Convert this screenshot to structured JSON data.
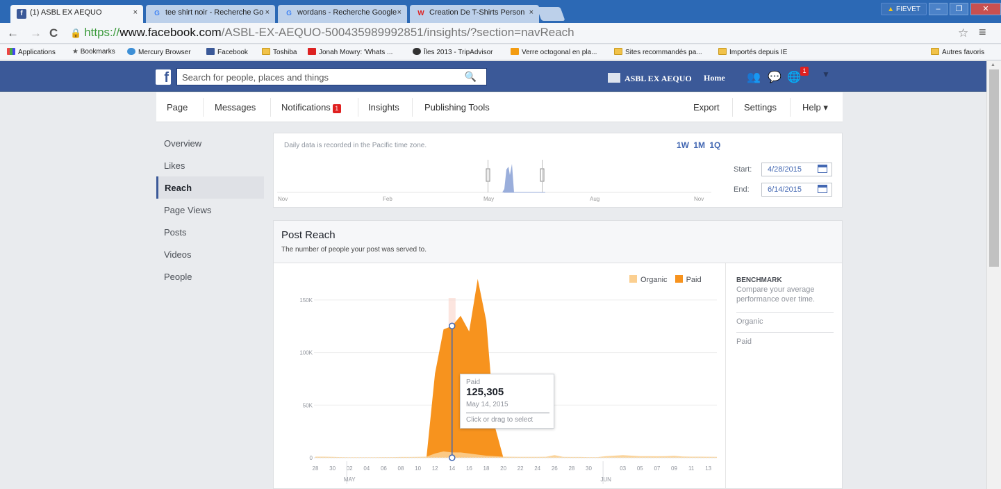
{
  "browser": {
    "tabs": [
      {
        "title": "(1) ASBL EX AEQUO",
        "favicon": "facebook-icon",
        "active": true
      },
      {
        "title": "tee shirt noir - Recherche Go",
        "favicon": "google-icon",
        "active": false
      },
      {
        "title": "wordans - Recherche Google",
        "favicon": "google-icon",
        "active": false
      },
      {
        "title": "Creation De T-Shirts Person",
        "favicon": "wordans-icon",
        "active": false
      }
    ],
    "user": "FIEVET",
    "url_scheme": "https://",
    "url_host": "www.facebook.com",
    "url_path": "/ASBL-EX-AEQUO-500435989992851/insights/?section=navReach",
    "bookmarks": [
      "Applications",
      "Bookmarks",
      "Mercury Browser",
      "Facebook",
      "Toshiba",
      "Jonah Mowry: 'Whats ...",
      "Îles 2013 - TripAdvisor",
      "Verre octogonal en pla...",
      "Sites recommandés pa...",
      "Importés depuis IE"
    ],
    "other_bookmarks": "Autres favoris"
  },
  "fb": {
    "search_placeholder": "Search for people, places and things",
    "page_name": "ASBL EX AEQUO",
    "home": "Home",
    "notif_count": "1"
  },
  "pagenav": {
    "page": "Page",
    "messages": "Messages",
    "notifications": "Notifications",
    "notifications_badge": "1",
    "insights": "Insights",
    "publishing": "Publishing Tools",
    "export": "Export",
    "settings": "Settings",
    "help": "Help ▾"
  },
  "sidebar": {
    "items": [
      "Overview",
      "Likes",
      "Reach",
      "Page Views",
      "Posts",
      "Videos",
      "People"
    ],
    "active": "Reach"
  },
  "timeline": {
    "note": "Daily data is recorded in the Pacific time zone.",
    "ranges": "1W 1M 1Q",
    "months": [
      "Nov",
      "Feb",
      "May",
      "Aug",
      "Nov"
    ],
    "start_label": "Start:",
    "start_date": "4/28/2015",
    "end_label": "End:",
    "end_date": "6/14/2015"
  },
  "reach": {
    "title": "Post Reach",
    "subtitle": "The number of people your post was served to."
  },
  "benchmark": {
    "title": "BENCHMARK",
    "desc": "Compare your average performance over time.",
    "organic": "Organic",
    "paid": "Paid"
  },
  "tooltip": {
    "series": "Paid",
    "value": "125,305",
    "date": "May 14, 2015",
    "hint": "Click or drag to select"
  },
  "colors": {
    "organic": "#fbcf90",
    "paid": "#f7931e",
    "fb_blue": "#3b5998",
    "link": "#4267b2"
  },
  "chart_data": {
    "type": "area",
    "title": "Post Reach",
    "legend": [
      "Organic",
      "Paid"
    ],
    "legend_position": "top-right",
    "ylim": [
      0,
      175000
    ],
    "yticks": [
      0,
      50000,
      100000,
      150000
    ],
    "ytick_labels": [
      "0",
      "50K",
      "100K",
      "150K"
    ],
    "x": [
      "28",
      "29",
      "30",
      "1",
      "02",
      "3",
      "04",
      "5",
      "06",
      "7",
      "08",
      "9",
      "10",
      "11",
      "12",
      "13",
      "14",
      "15",
      "16",
      "17",
      "18",
      "19",
      "20",
      "21",
      "22",
      "23",
      "24",
      "25",
      "26",
      "27",
      "28",
      "29",
      "30",
      "31",
      "01",
      "02",
      "03",
      "04",
      "05",
      "06",
      "07",
      "08",
      "09",
      "10",
      "11",
      "12",
      "13",
      "14"
    ],
    "xtick_labels": [
      "28",
      "30",
      "02",
      "04",
      "06",
      "08",
      "10",
      "12",
      "14",
      "16",
      "18",
      "20",
      "22",
      "24",
      "26",
      "28",
      "30",
      "",
      "03",
      "05",
      "07",
      "09",
      "11",
      "13"
    ],
    "month_labels": [
      "MAY",
      "JUN"
    ],
    "series": [
      {
        "name": "Paid",
        "values": [
          0,
          0,
          0,
          0,
          0,
          0,
          0,
          0,
          0,
          0,
          0,
          0,
          0,
          0,
          80000,
          122000,
          125305,
          135000,
          120000,
          170000,
          130000,
          30000,
          0,
          0,
          0,
          0,
          0,
          0,
          0,
          0,
          0,
          0,
          0,
          0,
          0,
          0,
          0,
          0,
          0,
          0,
          0,
          0,
          0,
          0,
          0,
          0,
          0,
          0
        ]
      },
      {
        "name": "Organic",
        "values": [
          1000,
          1000,
          800,
          600,
          500,
          500,
          500,
          500,
          600,
          600,
          700,
          700,
          800,
          1000,
          4000,
          6000,
          5000,
          5000,
          4000,
          3000,
          2000,
          1500,
          1000,
          900,
          800,
          800,
          800,
          900,
          2500,
          800,
          700,
          700,
          600,
          600,
          1500,
          2000,
          2500,
          2000,
          1500,
          1500,
          1400,
          1500,
          1800,
          1200,
          1000,
          1000,
          900,
          800
        ]
      }
    ],
    "highlight": {
      "series": "Paid",
      "x": "14",
      "value": 125305
    }
  }
}
